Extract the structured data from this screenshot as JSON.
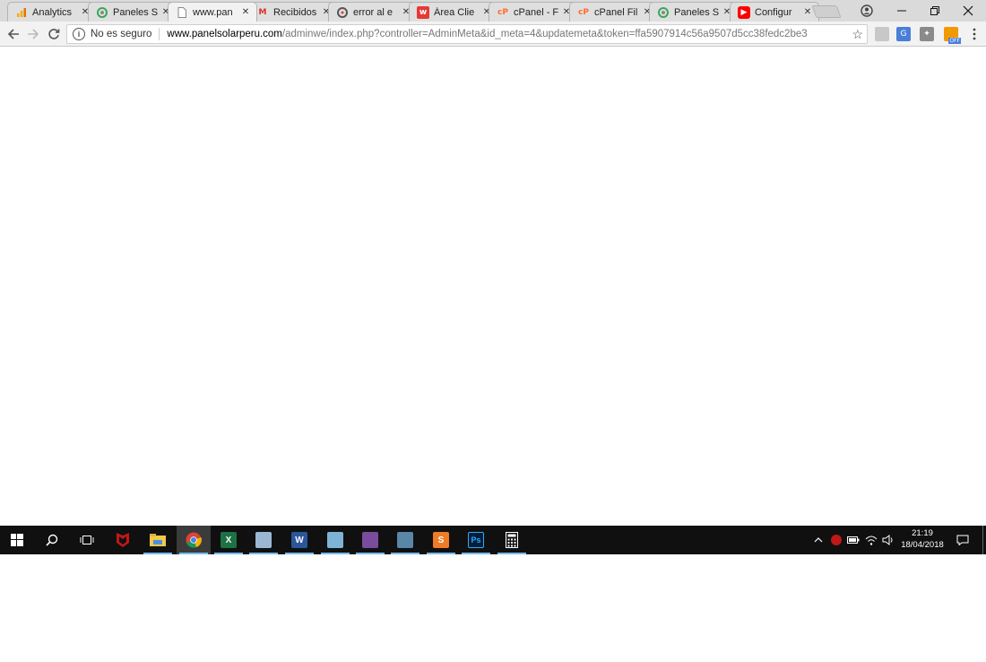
{
  "tabs": [
    {
      "title": "Analytics",
      "icon": "analytics-icon",
      "color": "#f9ab00"
    },
    {
      "title": "Paneles S",
      "icon": "panel-solar-icon",
      "color": "#3aa757"
    },
    {
      "title": "www.pan",
      "icon": "page-icon",
      "color": "#888888"
    },
    {
      "title": "Recibidos",
      "icon": "gmail-icon",
      "color": "#d93025"
    },
    {
      "title": "error al e",
      "icon": "google-icon",
      "color": "#555555"
    },
    {
      "title": "Área Clie",
      "icon": "w-logo-icon",
      "color": "#e53935"
    },
    {
      "title": "cPanel - F",
      "icon": "cpanel-icon",
      "color": "#ff6c2c"
    },
    {
      "title": "cPanel Fil",
      "icon": "cpanel-icon",
      "color": "#ff6c2c"
    },
    {
      "title": "Paneles S",
      "icon": "panel-solar-icon",
      "color": "#3aa757"
    },
    {
      "title": "Configur",
      "icon": "youtube-icon",
      "color": "#ff0000"
    }
  ],
  "omnibox": {
    "security_label": "No es seguro",
    "host": "www.panelsolarperu.com",
    "path": "/adminwe/index.php?controller=AdminMeta&id_meta=4&updatemeta&token=ffa5907914c56a9507d5cc38fedc2be3"
  },
  "extensions": {
    "badge_off": "OFF"
  },
  "taskbar": {
    "apps": [
      {
        "name": "mcafee",
        "label": "",
        "color": "#c01818"
      },
      {
        "name": "file-explorer",
        "label": "",
        "color": "#f2c94c"
      },
      {
        "name": "chrome",
        "label": "",
        "color": "#4285f4"
      },
      {
        "name": "excel",
        "label": "X",
        "color": "#1e7145"
      },
      {
        "name": "paint",
        "label": "",
        "color": "#9bb7d4"
      },
      {
        "name": "word",
        "label": "W",
        "color": "#2b579a"
      },
      {
        "name": "notepad",
        "label": "",
        "color": "#7fb3d5"
      },
      {
        "name": "winrar",
        "label": "",
        "color": "#7a4c9e"
      },
      {
        "name": "screenshot",
        "label": "",
        "color": "#5a86a8"
      },
      {
        "name": "sublime-text",
        "label": "S",
        "color": "#ef7c26"
      },
      {
        "name": "photoshop",
        "label": "Ps",
        "color": "#001e36"
      },
      {
        "name": "calculator",
        "label": "",
        "color": "#444444"
      }
    ],
    "time": "21:19",
    "date": "18/04/2018"
  }
}
